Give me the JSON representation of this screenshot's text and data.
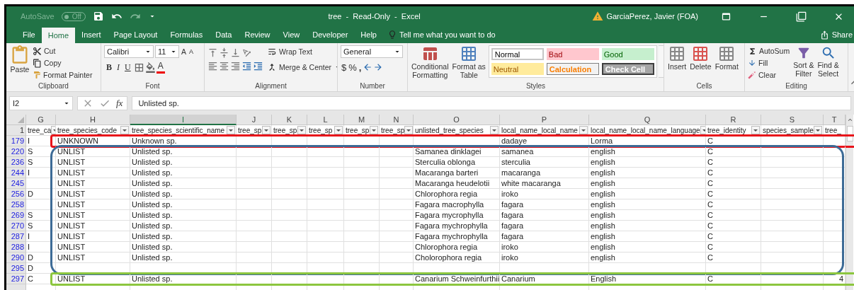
{
  "title_bar": {
    "autosave": {
      "label": "AutoSave",
      "state": "Off",
      "on": false
    },
    "title": "tree  -  Read-Only  -  Excel",
    "user": "GarciaPerez, Javier (FOA)"
  },
  "menu": {
    "tabs": [
      {
        "label": "File",
        "selected": false
      },
      {
        "label": "Home",
        "selected": true
      },
      {
        "label": "Insert",
        "selected": false
      },
      {
        "label": "Page Layout",
        "selected": false
      },
      {
        "label": "Formulas",
        "selected": false
      },
      {
        "label": "Data",
        "selected": false
      },
      {
        "label": "Review",
        "selected": false
      },
      {
        "label": "View",
        "selected": false
      },
      {
        "label": "Developer",
        "selected": false
      },
      {
        "label": "Help",
        "selected": false
      }
    ],
    "tell_me": "Tell me what you want to do",
    "share": "Share"
  },
  "ribbon": {
    "clipboard": {
      "paste": "Paste",
      "cut": "Cut",
      "copy": "Copy",
      "format_painter": "Format Painter",
      "group": "Clipboard"
    },
    "font": {
      "name": "Calibri",
      "size": "11",
      "grow": "A",
      "shrink": "A",
      "bold": "B",
      "italic": "I",
      "underline": "U",
      "text_color_letter": "A",
      "group": "Font"
    },
    "alignment": {
      "wrap": "Wrap Text",
      "merge": "Merge & Center",
      "group": "Alignment"
    },
    "number": {
      "format": "General",
      "currency": "$",
      "percent": "%",
      "comma": ",",
      "group": "Number"
    },
    "styles": {
      "conditional": [
        "Conditional",
        "Formatting"
      ],
      "table": [
        "Format as",
        "Table"
      ],
      "gallery": [
        {
          "label": "Normal",
          "kind": "normal"
        },
        {
          "label": "Bad",
          "kind": "bad"
        },
        {
          "label": "Good",
          "kind": "good"
        },
        {
          "label": "Neutral",
          "kind": "neutral"
        },
        {
          "label": "Calculation",
          "kind": "calculation"
        },
        {
          "label": "Check Cell",
          "kind": "check"
        }
      ],
      "group": "Styles"
    },
    "cells": {
      "buttons": [
        "Insert",
        "Delete",
        "Format"
      ],
      "group": "Cells"
    },
    "editing": {
      "autosum": "AutoSum",
      "fill": "Fill",
      "clear": "Clear",
      "sort": [
        "Sort &",
        "Filter"
      ],
      "find": [
        "Find &",
        "Select"
      ],
      "group": "Editing"
    }
  },
  "formula_bar": {
    "name_box": "I2",
    "fx": "fx",
    "value": "Unlisted sp."
  },
  "sheet": {
    "columns": [
      {
        "letter": "G",
        "header": "tree_ca",
        "selected": false
      },
      {
        "letter": "H",
        "header": "tree_species_code",
        "selected": false
      },
      {
        "letter": "I",
        "header": "tree_species_scientific_name",
        "selected": true
      },
      {
        "letter": "J",
        "header": "tree_sp",
        "selected": false
      },
      {
        "letter": "K",
        "header": "tree_sp",
        "selected": false
      },
      {
        "letter": "L",
        "header": "tree_sp",
        "selected": false
      },
      {
        "letter": "M",
        "header": "tree_sp",
        "selected": false
      },
      {
        "letter": "N",
        "header": "tree_sp",
        "selected": false
      },
      {
        "letter": "O",
        "header": "unlisted_tree_species",
        "selected": false
      },
      {
        "letter": "P",
        "header": "local_name_local_name",
        "selected": false
      },
      {
        "letter": "Q",
        "header": "local_name_local_name_language",
        "selected": false
      },
      {
        "letter": "R",
        "header": "tree_identity",
        "selected": false
      },
      {
        "letter": "S",
        "header": "species_sample",
        "selected": false
      },
      {
        "letter": "T",
        "header": "tree_",
        "selected": false
      }
    ],
    "header_row": "1",
    "rows": [
      {
        "number": "179",
        "color": "#e8141b",
        "cells": [
          "I",
          "UNKNOWN",
          "Unknown sp.",
          null,
          null,
          null,
          null,
          null,
          null,
          "dadaye",
          "Lorma",
          "C",
          null,
          null
        ]
      },
      {
        "number": "220",
        "color": "#3d6b96",
        "cells": [
          "S",
          "UNLIST",
          "Unlisted sp.",
          null,
          null,
          null,
          null,
          null,
          "Samanea dinklagei",
          "samanea",
          "english",
          "C",
          null,
          null
        ]
      },
      {
        "number": "236",
        "color": "#3d6b96",
        "cells": [
          "S",
          "UNLIST",
          "Unlisted sp.",
          null,
          null,
          null,
          null,
          null,
          "Sterculia oblonga",
          "sterculia",
          "english",
          "C",
          null,
          null
        ]
      },
      {
        "number": "244",
        "color": "#3d6b96",
        "cells": [
          "I",
          "UNLIST",
          "Unlisted sp.",
          null,
          null,
          null,
          null,
          null,
          "Macaranga barteri",
          "macaranga",
          "english",
          "C",
          null,
          null
        ]
      },
      {
        "number": "245",
        "color": "#3d6b96",
        "cells": [
          null,
          "UNLIST",
          "Unlisted sp.",
          null,
          null,
          null,
          null,
          null,
          "Macaranga heudelotii",
          "white macaranga",
          "english",
          "C",
          null,
          null
        ]
      },
      {
        "number": "256",
        "color": "#3d6b96",
        "cells": [
          "D",
          "UNLIST",
          "Unlisted sp.",
          null,
          null,
          null,
          null,
          null,
          "Chlorophora regia",
          "iroko",
          "english",
          "C",
          null,
          null
        ]
      },
      {
        "number": "258",
        "color": "#3d6b96",
        "cells": [
          null,
          "UNLIST",
          "Unlisted sp.",
          null,
          null,
          null,
          null,
          null,
          "Fagara macrophylla",
          "fagara",
          "english",
          "C",
          null,
          null
        ]
      },
      {
        "number": "269",
        "color": "#3d6b96",
        "cells": [
          "S",
          "UNLIST",
          "Unlisted sp.",
          null,
          null,
          null,
          null,
          null,
          "Fagara mycrophylla",
          "fagara",
          "english",
          "C",
          null,
          null
        ]
      },
      {
        "number": "270",
        "color": "#3d6b96",
        "cells": [
          "S",
          "UNLIST",
          "Unlisted sp.",
          null,
          null,
          null,
          null,
          null,
          "Fagara mychrophylla",
          "fagara",
          "english",
          "C",
          null,
          null
        ]
      },
      {
        "number": "287",
        "color": "#3d6b96",
        "cells": [
          "I",
          "UNLIST",
          "Unlisted sp.",
          null,
          null,
          null,
          null,
          null,
          "Fagara mychrophylla",
          "fagara",
          "english",
          "C",
          null,
          null
        ]
      },
      {
        "number": "288",
        "color": "#3d6b96",
        "cells": [
          "I",
          "UNLIST",
          "Unlisted sp.",
          null,
          null,
          null,
          null,
          null,
          "Chlorophora regia",
          "iroko",
          "english",
          "C",
          null,
          null
        ]
      },
      {
        "number": "290",
        "color": "#3d6b96",
        "cells": [
          "D",
          "UNLIST",
          "Unlisted sp.",
          null,
          null,
          null,
          null,
          null,
          "Cholorophora regia",
          "iroko",
          "english",
          "C",
          null,
          null
        ]
      },
      {
        "number": "295",
        "color": "#3d6b96",
        "cells": [
          "D",
          null,
          null,
          null,
          null,
          null,
          null,
          null,
          null,
          null,
          null,
          null,
          null,
          null
        ]
      },
      {
        "number": "297",
        "color": "#8cc63f",
        "cells": [
          "C",
          "UNLIST",
          "Unlisted sp.",
          null,
          null,
          null,
          null,
          null,
          "Canarium Schweinfurthii",
          "Canarium",
          "English",
          "C",
          null,
          "4"
        ]
      }
    ]
  }
}
